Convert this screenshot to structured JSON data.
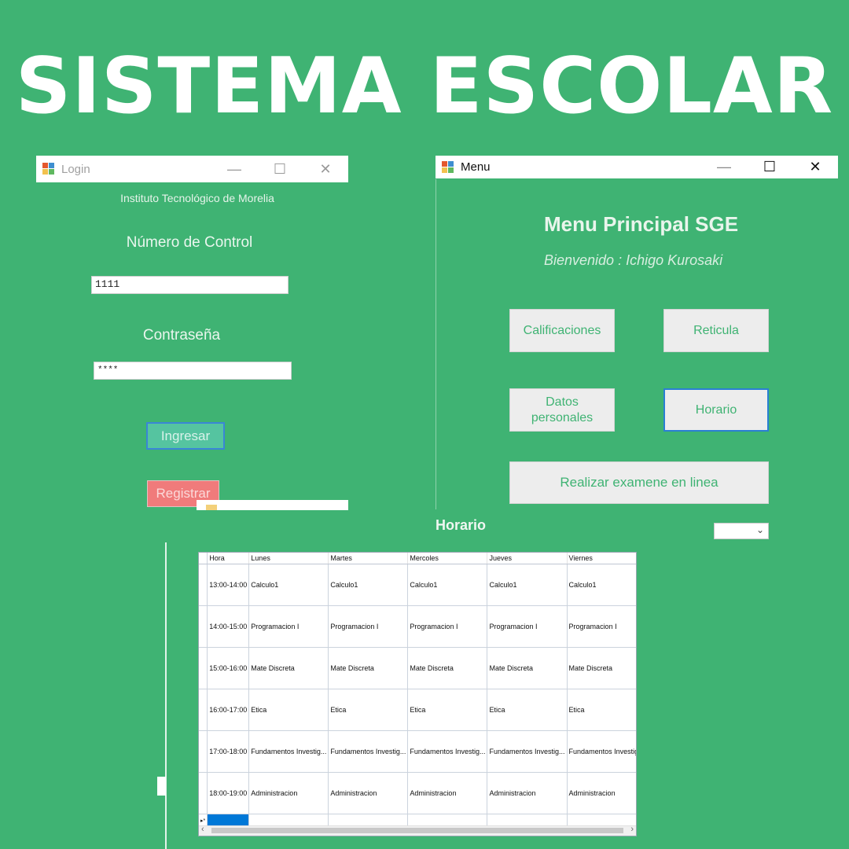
{
  "banner": {
    "title": "SISTEMA ESCOLAR"
  },
  "login": {
    "window_title": "Login",
    "institution": "Instituto Tecnológico de Morelia",
    "control_label": "Número de Control",
    "control_value": "1111",
    "password_label": "Contraseña",
    "password_value": "****",
    "login_button": "Ingresar",
    "register_button": "Registrar"
  },
  "menu": {
    "window_title": "Menu",
    "heading": "Menu Principal SGE",
    "welcome": "Bienvenido : Ichigo Kurosaki",
    "buttons": {
      "grades": "Calificaciones",
      "reticula": "Reticula",
      "personal_data": "Datos personales",
      "schedule": "Horario",
      "online_exam": "Realizar examene en linea"
    }
  },
  "window_controls": {
    "minimize": "—",
    "maximize": "☐",
    "close": "✕"
  },
  "horario": {
    "title": "Horario",
    "combo_value": "",
    "columns": [
      "Hora",
      "Lunes",
      "Martes",
      "Mercoles",
      "Jueves",
      "Viernes"
    ],
    "rows": [
      [
        "13:00-14:00",
        "Calculo1",
        "Calculo1",
        "Calculo1",
        "Calculo1",
        "Calculo1"
      ],
      [
        "14:00-15:00",
        "Programacion I",
        "Programacion I",
        "Programacion I",
        "Programacion I",
        "Programacion I"
      ],
      [
        "15:00-16:00",
        "Mate Discreta",
        "Mate Discreta",
        "Mate Discreta",
        "Mate Discreta",
        "Mate Discreta"
      ],
      [
        "16:00-17:00",
        "Etica",
        "Etica",
        "Etica",
        "Etica",
        "Etica"
      ],
      [
        "17:00-18:00",
        "Fundamentos Investig...",
        "Fundamentos Investig...",
        "Fundamentos Investig...",
        "Fundamentos Investig...",
        "Fundamentos Investig..."
      ],
      [
        "18:00-19:00",
        "Administracion",
        "Administracion",
        "Administracion",
        "Administracion",
        "Administracion"
      ]
    ],
    "new_row_marker": "▸*"
  },
  "icons": [
    "app-icon",
    "minimize-icon",
    "maximize-icon",
    "close-icon",
    "chevron-down-icon",
    "scroll-left-icon",
    "scroll-right-icon"
  ],
  "colors": {
    "background": "#3fb373",
    "accent_blue": "#0078d7",
    "login_button": "#55c4a0",
    "register_button": "#f07b7b"
  }
}
